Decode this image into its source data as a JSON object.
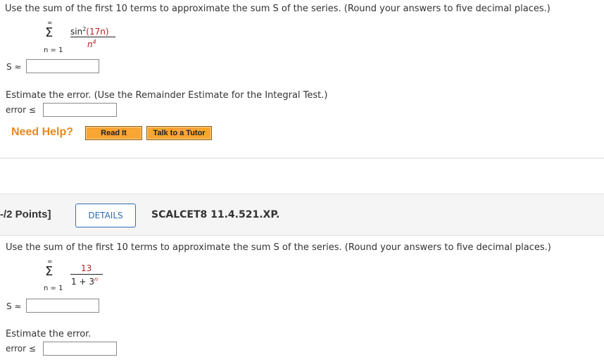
{
  "q1": {
    "instruction": "Use the sum of the first 10 terms to approximate the sum S of the series. (Round your answers to five decimal places.)",
    "series": {
      "upper": "∞",
      "sigma": "Σ",
      "numerator_fn": "sin",
      "numerator_exp": "2",
      "numerator_arg": "(17n)",
      "denominator_base": "n",
      "denominator_exp": "4",
      "lower": "n = 1"
    },
    "s_label": "S ≈",
    "s_value": "",
    "error_instruction": "Estimate the error. (Use the Remainder Estimate for the Integral Test.)",
    "error_label": "error ≤",
    "error_value": "",
    "need_help": "Need Help?",
    "read_it": "Read It",
    "talk_tutor": "Talk to a Tutor"
  },
  "q2": {
    "points": "-/2 Points]",
    "details": "DETAILS",
    "code": "SCALCET8 11.4.521.XP.",
    "instruction": "Use the sum of the first 10 terms to approximate the sum S of the series. (Round your answers to five decimal places.)",
    "series": {
      "upper": "∞",
      "sigma": "Σ",
      "numerator": "13",
      "denominator": "1 + 3",
      "denominator_exp": "n",
      "lower": "n = 1"
    },
    "s_label": "S ≈",
    "s_value": "",
    "error_instruction": "Estimate the error.",
    "error_label": "error ≤",
    "error_value": ""
  },
  "colors": {
    "help_orange": "#e8891c",
    "button_orange": "#f7a533",
    "details_blue": "#2e6db4",
    "math_red": "#b22222"
  }
}
